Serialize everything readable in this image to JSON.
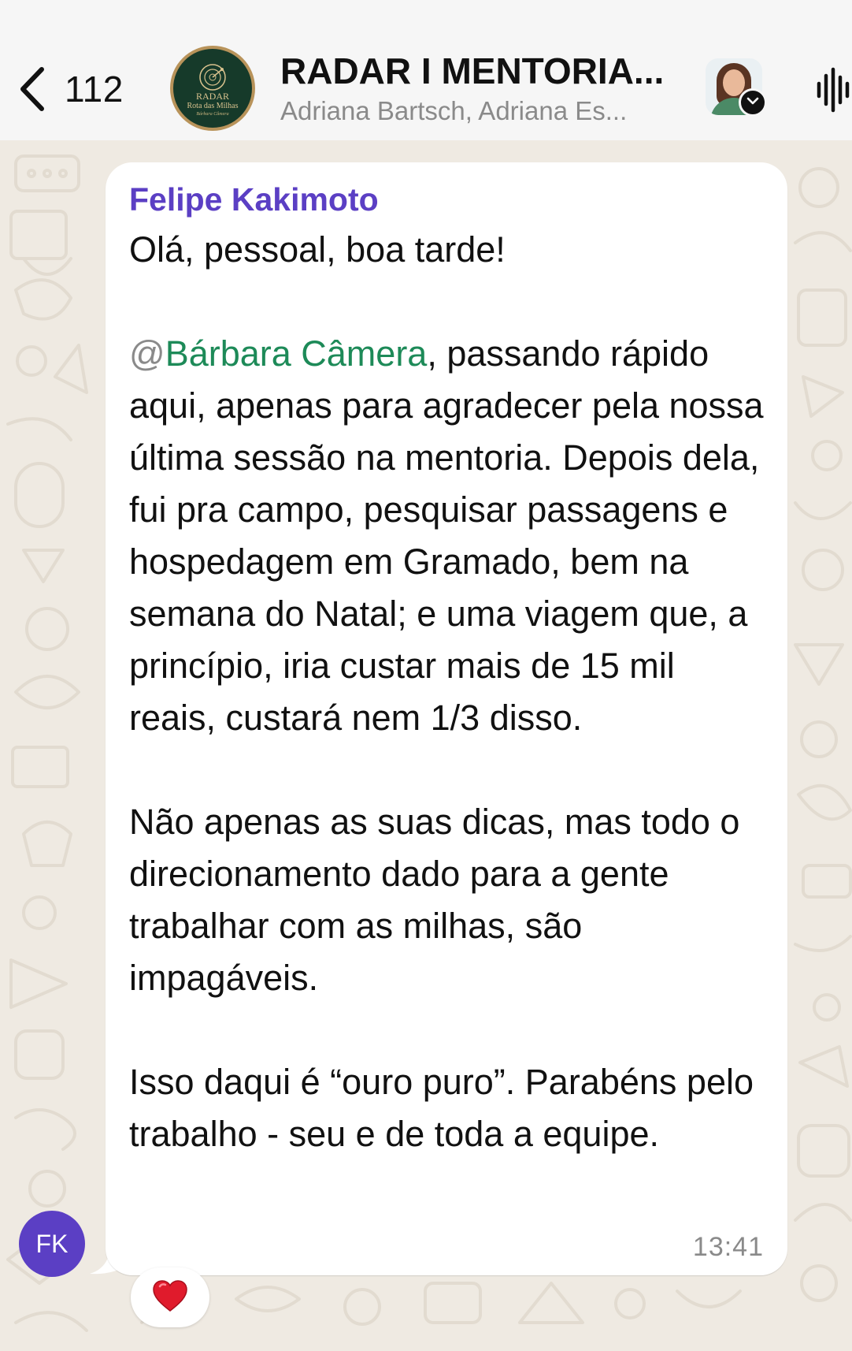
{
  "header": {
    "back_count": "112",
    "title": "RADAR I MENTORIA...",
    "subtitle": "Adriana Bartsch, Adriana Es...",
    "group_avatar": {
      "line1": "RADAR",
      "line2": "Rota das Milhas",
      "line3": "Bárbara Câmera"
    },
    "icons": {
      "back": "chevron-left-icon",
      "dropdown": "chevron-down-icon",
      "voice": "waveform-icon"
    }
  },
  "message": {
    "sender": "Felipe Kakimoto",
    "sender_color": "#5b3fc4",
    "sender_initials": "FK",
    "greeting": "Olá, pessoal, boa tarde!",
    "mention_at": "@",
    "mention_name": "Bárbara Câmera",
    "mention_color": "#1d8a58",
    "p1_rest": ", passando rápido aqui, apenas para agradecer pela nossa última sessão na mentoria. Depois dela, fui pra campo, pesquisar passagens e hospedagem em Gramado, bem na semana do Natal; e uma viagem que, a princípio, iria custar mais de 15 mil reais, custará nem 1/3 disso.",
    "p2": "Não apenas as suas dicas, mas todo o direcionamento dado para a gente trabalhar com as milhas, são impagáveis.",
    "p3": "Isso daqui é “ouro puro”. Parabéns pelo trabalho - seu e de toda a equipe.",
    "time": "13:41",
    "reaction": "❤️"
  },
  "colors": {
    "header_bg": "#f6f6f6",
    "wallpaper": "#efeae2",
    "bubble": "#ffffff"
  }
}
